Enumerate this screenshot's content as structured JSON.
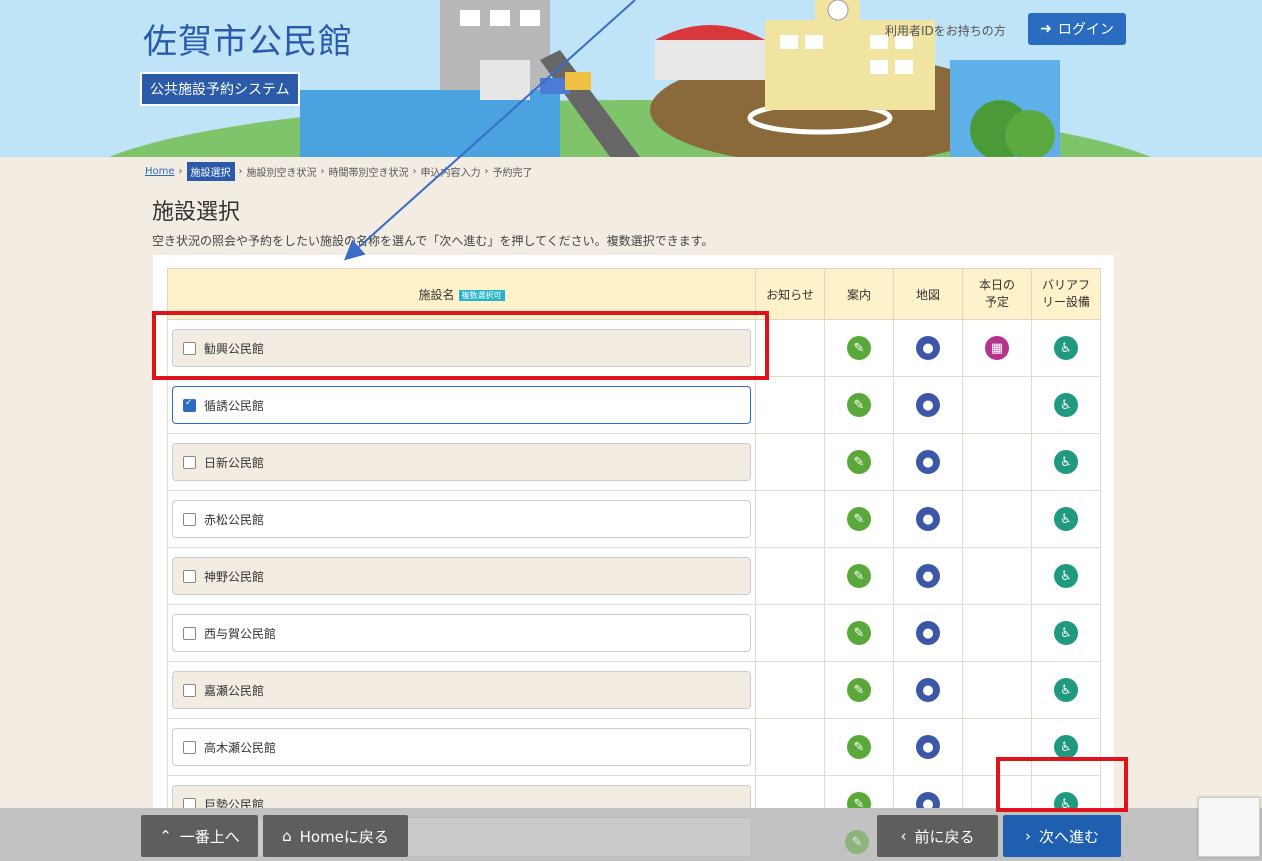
{
  "header": {
    "site_title": "佐賀市公民館",
    "system_name": "公共施設予約システム",
    "login_prompt": "利用者IDをお持ちの方",
    "login_label": "ログイン"
  },
  "breadcrumb": {
    "home": "Home",
    "current": "施設選択",
    "steps": [
      "施設別空き状況",
      "時間帯別空き状況",
      "申込内容入力",
      "予約完了"
    ]
  },
  "page_title": "施設選択",
  "instructions": "空き状況の照会や予約をしたい施設の名称を選んで「次へ進む」を押してください。複数選択できます。",
  "table": {
    "headers": {
      "name": "施設名",
      "multi_badge": "複数選択可",
      "notice": "お知らせ",
      "guide": "案内",
      "map": "地図",
      "today": "本日の予定",
      "barrier_free": "バリアフリー設備"
    },
    "rows": [
      {
        "name": "勧興公民館",
        "checked": false,
        "today": true
      },
      {
        "name": "循誘公民館",
        "checked": true,
        "today": false
      },
      {
        "name": "日新公民館",
        "checked": false,
        "today": false
      },
      {
        "name": "赤松公民館",
        "checked": false,
        "today": false
      },
      {
        "name": "神野公民館",
        "checked": false,
        "today": false
      },
      {
        "name": "西与賀公民館",
        "checked": false,
        "today": false
      },
      {
        "name": "嘉瀬公民館",
        "checked": false,
        "today": false
      },
      {
        "name": "高木瀬公民館",
        "checked": false,
        "today": false
      },
      {
        "name": "巨勢公民館",
        "checked": false,
        "today": false
      }
    ]
  },
  "footer": {
    "top_label": "一番上へ",
    "home_label": "Homeに戻る",
    "back_label": "前に戻る",
    "next_label": "次へ進む"
  },
  "colors": {
    "accent": "#2a5aa8",
    "annotation": "#e0121b",
    "arrow": "#3a6cc8"
  }
}
